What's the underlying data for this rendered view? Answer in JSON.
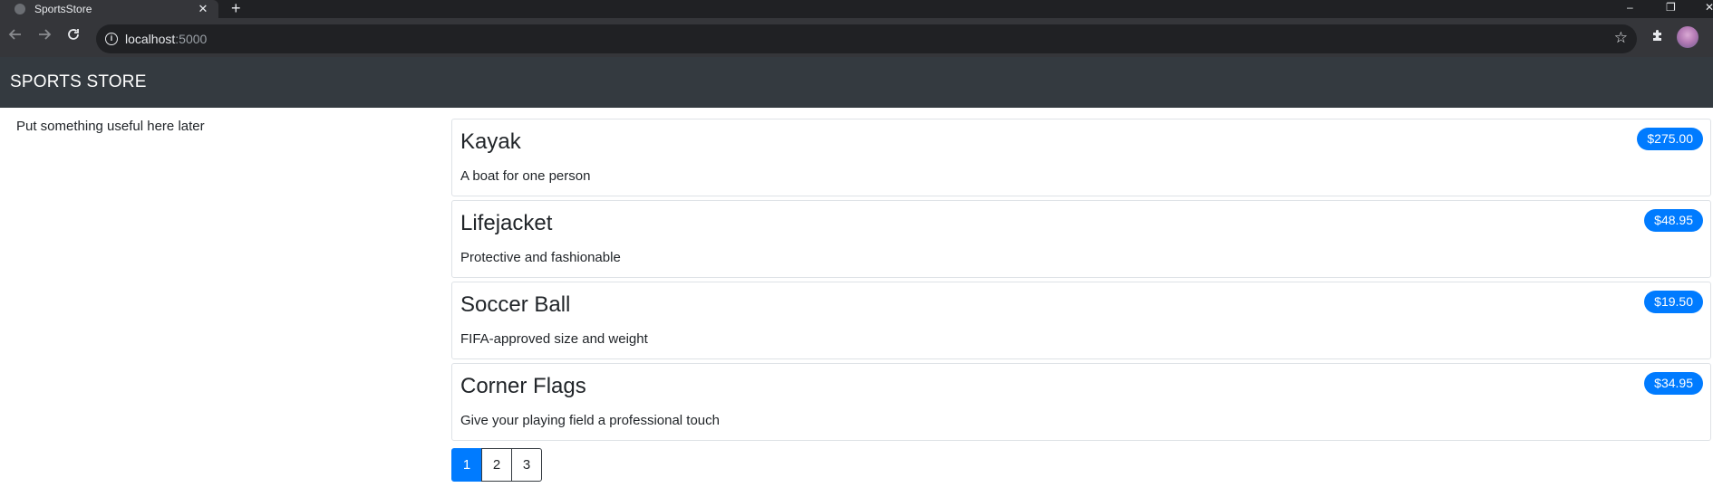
{
  "browser": {
    "tab_title": "SportsStore",
    "tab_close": "✕",
    "new_tab": "+",
    "url_host": "localhost",
    "url_port": ":5000",
    "minimize": "–",
    "restore": "❐",
    "close": "✕"
  },
  "navbar": {
    "brand": "SPORTS STORE"
  },
  "sidebar": {
    "text": "Put something useful here later"
  },
  "products": [
    {
      "name": "Kayak",
      "description": "A boat for one person",
      "price": "$275.00"
    },
    {
      "name": "Lifejacket",
      "description": "Protective and fashionable",
      "price": "$48.95"
    },
    {
      "name": "Soccer Ball",
      "description": "FIFA-approved size and weight",
      "price": "$19.50"
    },
    {
      "name": "Corner Flags",
      "description": "Give your playing field a professional touch",
      "price": "$34.95"
    }
  ],
  "pagination": {
    "pages": [
      "1",
      "2",
      "3"
    ],
    "current": "1"
  },
  "colors": {
    "navbar": "#343a40",
    "accent": "#007bff"
  }
}
